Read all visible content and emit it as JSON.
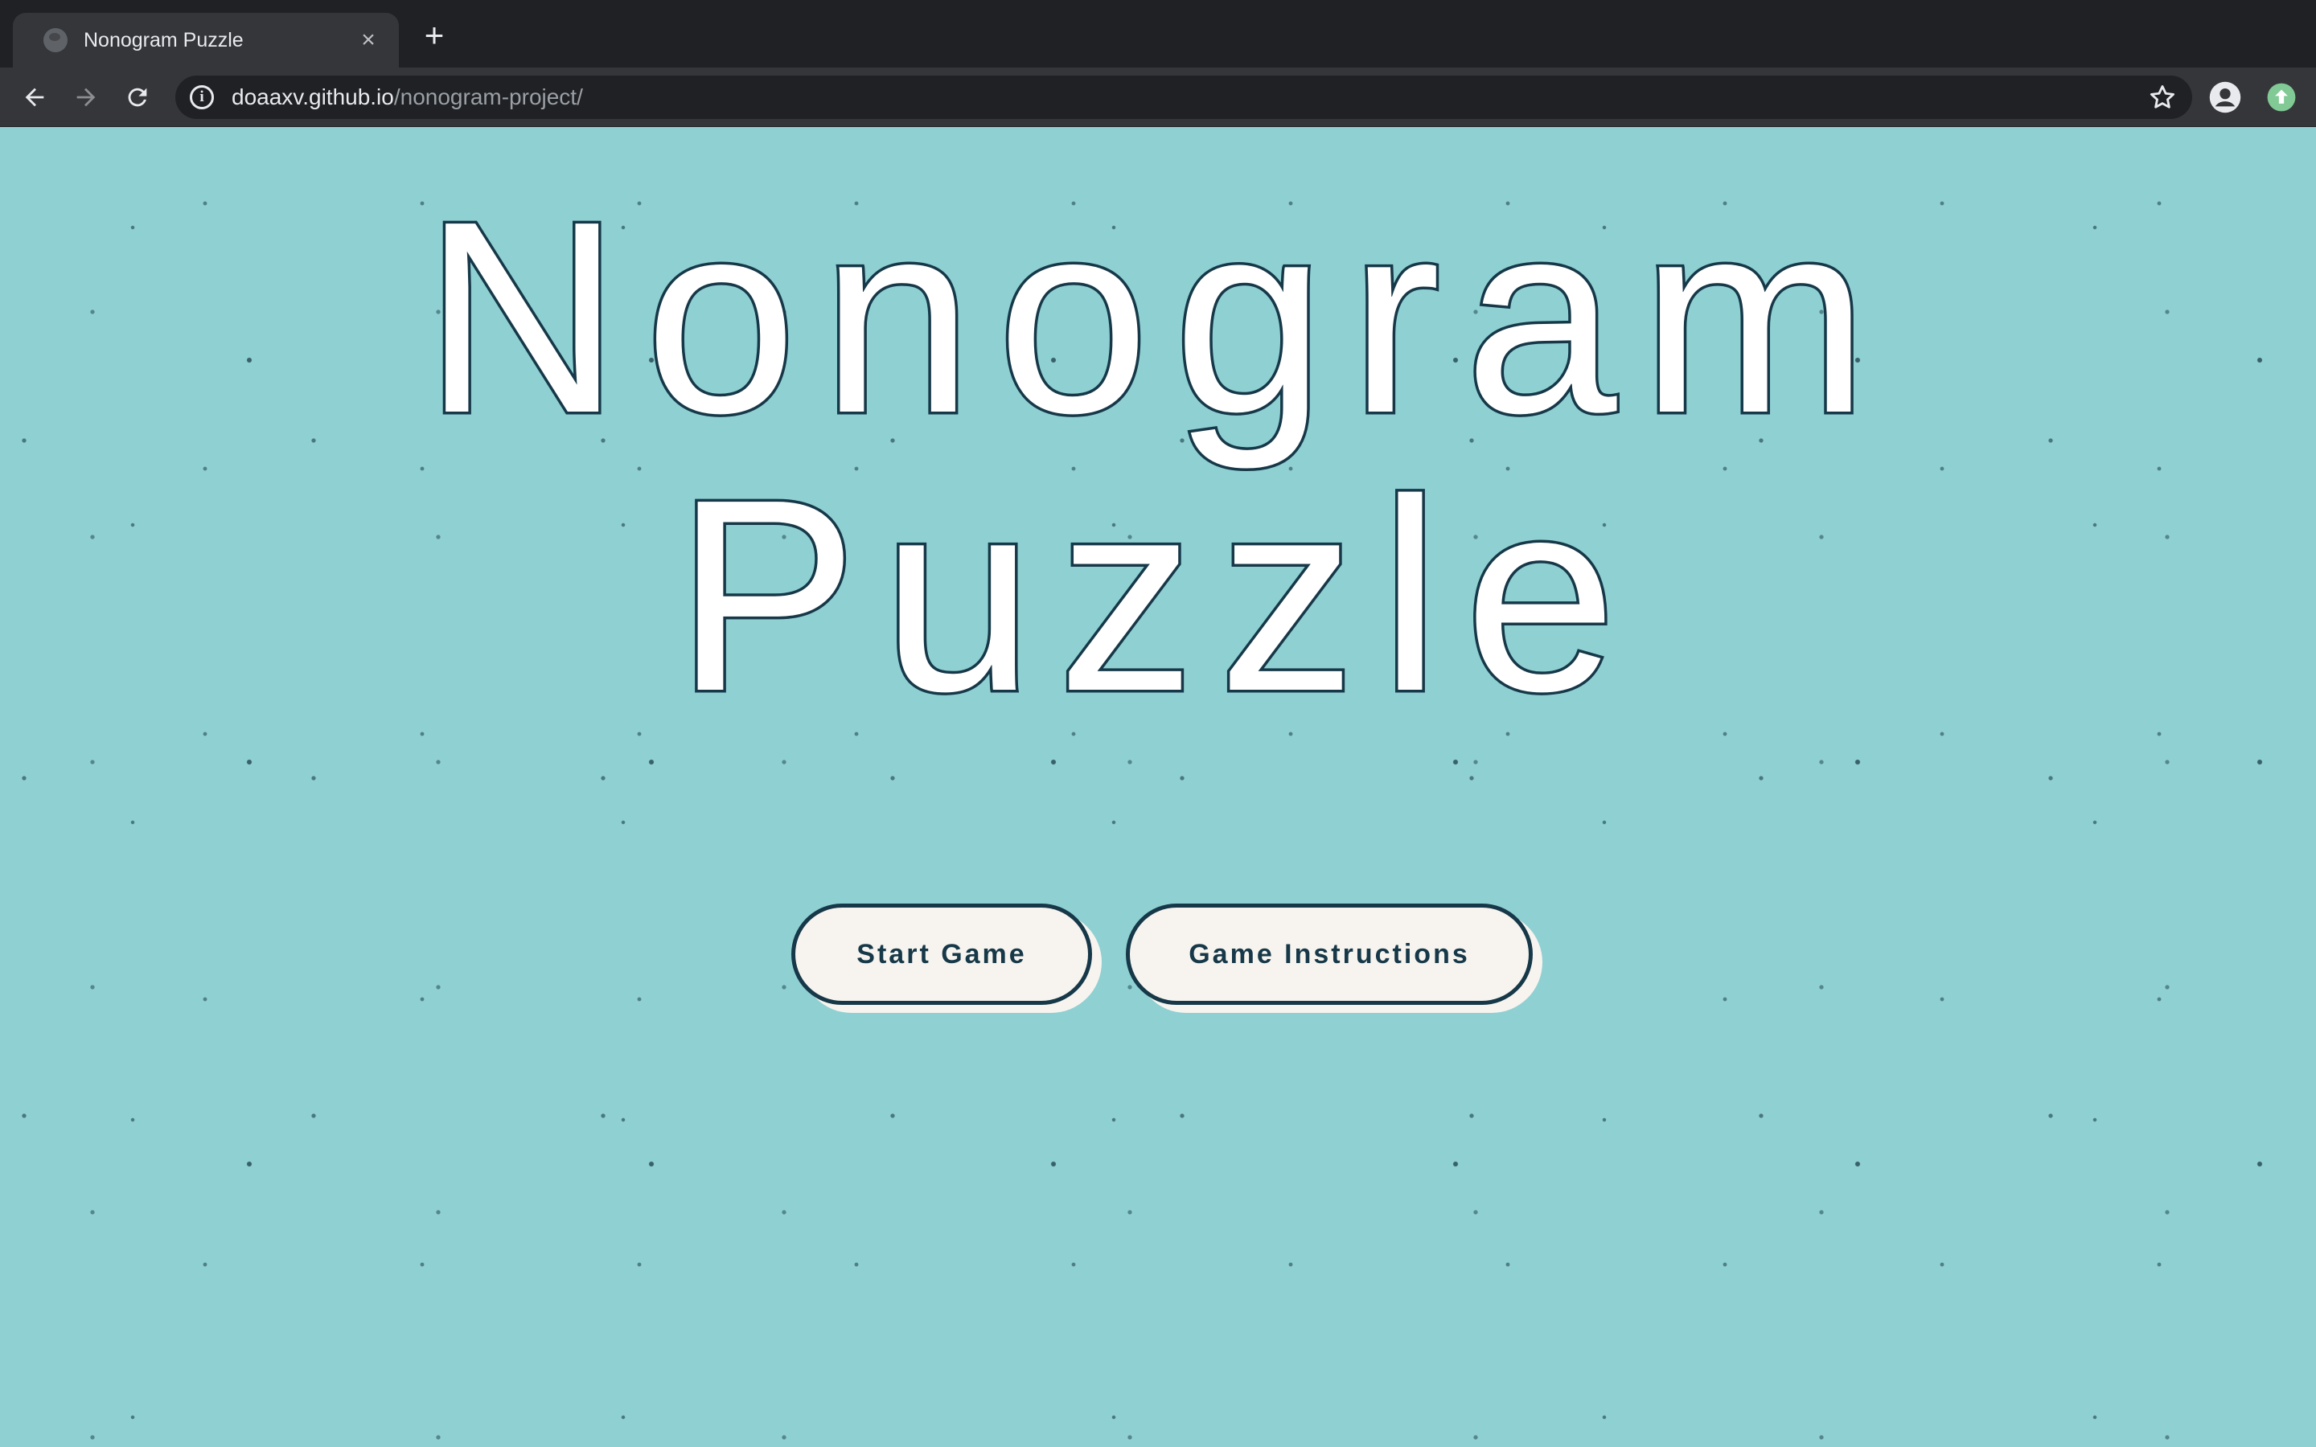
{
  "browser": {
    "tab_title": "Nonogram Puzzle",
    "tab_close": "×",
    "new_tab": "+",
    "url_host": "doaaxv.github.io",
    "url_path": "/nonogram-project/"
  },
  "page": {
    "title_line1": "Nonogram",
    "title_line2": "Puzzle",
    "start_button": "Start Game",
    "instructions_button": "Game Instructions"
  },
  "colors": {
    "background": "#8fd0d3",
    "outline": "#163848",
    "button_fill": "#f7f4ef"
  }
}
